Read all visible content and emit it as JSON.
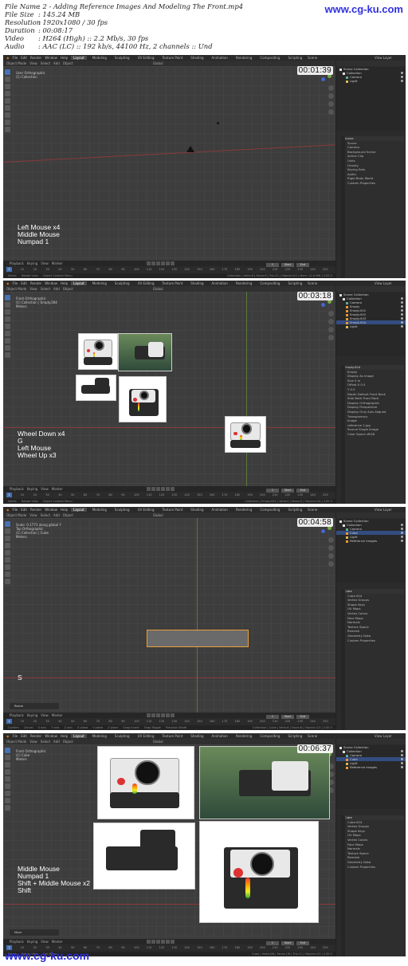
{
  "header": {
    "rows": [
      {
        "label": "File Name",
        "value": ":  2 - Adding Reference Images And Modeling The Front.mp4"
      },
      {
        "label": "File Size",
        "value": ":  145.24 MB"
      },
      {
        "label": "Resolution",
        "value": ":  1920x1080 / 30 fps"
      },
      {
        "label": "Duration",
        "value": ":  00:08:17"
      },
      {
        "label": "Video",
        "value": ":  H264 (High) :: 2.2 Mb/s, 30 fps"
      },
      {
        "label": "Audio",
        "value": ":  AAC (LC) :: 192 kb/s, 44100 Hz, 2 channels :: Und"
      }
    ]
  },
  "watermark": {
    "top": "www.cg-ku.com",
    "bottom": "www.cg-ku.com"
  },
  "menu": {
    "items": [
      "File",
      "Edit",
      "Render",
      "Window",
      "Help"
    ],
    "workspaces": [
      "Layout",
      "Modeling",
      "Sculpting",
      "UV Editing",
      "Texture Paint",
      "Shading",
      "Animation",
      "Rendering",
      "Compositing",
      "Scripting"
    ],
    "scene": "Scene",
    "view_layer": "View Layer"
  },
  "viewport_header": {
    "mode": "Object Mode",
    "menu": [
      "View",
      "Select",
      "Add",
      "Object"
    ],
    "transform": "Global"
  },
  "timeline": {
    "menu": [
      "Playback",
      "Keying",
      "View",
      "Marker"
    ],
    "frame": "1",
    "start_label": "Start",
    "start": "1",
    "end_label": "End",
    "end": "250",
    "ticks": [
      "0",
      "10",
      "20",
      "30",
      "40",
      "50",
      "60",
      "70",
      "80",
      "90",
      "100",
      "110",
      "120",
      "130",
      "140",
      "150",
      "160",
      "170",
      "180",
      "190",
      "200",
      "210",
      "220",
      "230",
      "240",
      "250"
    ]
  },
  "frames": [
    {
      "timestamp": "00:01:39",
      "view_title": "User Orthographic",
      "view_sub": "(1) Collection",
      "keys": [
        "Left Mouse x4",
        "Middle Mouse",
        "Numpad 1"
      ],
      "status": [
        "Select",
        "Rotate View",
        "Object Context Menu"
      ],
      "status_right": "Collection | Verts:8 | Faces:6 | Tris:12 | Objects:0/3 | Mem: 12.8 MiB | 2.83.3",
      "outliner": [
        {
          "name": "Scene Collection",
          "sel": false
        },
        {
          "name": "Collection",
          "sel": false
        },
        {
          "name": "Camera",
          "sel": false
        },
        {
          "name": "Light",
          "sel": false
        }
      ],
      "props_title": "Scene",
      "props_rows": [
        "Scene",
        "Camera",
        "Background Scene",
        "Active Clip",
        "Units",
        "Gravity",
        "Keying Sets",
        "Audio",
        "Rigid Body World",
        "Custom Properties"
      ]
    },
    {
      "timestamp": "00:03:18",
      "view_title": "Front Orthographic",
      "view_sub": "(1) Collection | Empty.004",
      "view_unit": "Meters",
      "keys": [
        "Wheel Down x4",
        "G",
        "Left Mouse",
        "Wheel Up x3"
      ],
      "status": [
        "Select",
        "Rotate View",
        "Object Context Menu"
      ],
      "status_right": "Collection | Empty.004 | Verts:0 | Faces:0 | Objects:1/6 | 2.83.3",
      "outliner": [
        {
          "name": "Scene Collection",
          "sel": false
        },
        {
          "name": "Collection",
          "sel": false
        },
        {
          "name": "Camera",
          "sel": false
        },
        {
          "name": "Empty",
          "sel": false
        },
        {
          "name": "Empty.001",
          "sel": false
        },
        {
          "name": "Empty.002",
          "sel": false
        },
        {
          "name": "Empty.003",
          "sel": false
        },
        {
          "name": "Empty.004",
          "sel": true
        },
        {
          "name": "Light",
          "sel": false
        }
      ],
      "props_title": "Empty.004",
      "props_rows": [
        "Empty",
        "Display As  Image",
        "Size  5 m",
        "Offset X  0.5",
        "Y  0.5",
        "Depth  Default  Front  Back",
        "Side  Both  Front  Back",
        "Display Orthographic",
        "Display Perspective",
        "Display Only Axis Aligned",
        "Transparency",
        "Image",
        "reference 2.jpg",
        "Source  Single Image",
        "Color Space  sRGB"
      ]
    },
    {
      "timestamp": "00:04:58",
      "view_title": "Top Orthographic",
      "view_sub": "(1) Collection | Cube",
      "view_unit": "Meters",
      "view_scale": "Scale: 0.1773  along global Y",
      "keys": [
        "S"
      ],
      "op_panel": "Resize",
      "status": [
        "Confirm",
        "Cancel",
        "X axis",
        "Y axis",
        "Z axis",
        "X plane",
        "Y plane",
        "Z plane",
        "Snap Invert",
        "Snap Toggle",
        "Precision Mode"
      ],
      "status_right": "Collection | Cube | Verts:8 | Faces:6 | Objects:1/3 | 2.83.3",
      "outliner": [
        {
          "name": "Scene Collection",
          "sel": false
        },
        {
          "name": "Collection",
          "sel": false
        },
        {
          "name": "Camera",
          "sel": false
        },
        {
          "name": "Cube",
          "sel": true
        },
        {
          "name": "Light",
          "sel": false
        },
        {
          "name": "Reference images",
          "sel": false
        }
      ],
      "props_title": "Cube",
      "props_rows": [
        "Cube.004",
        "Vertex Groups",
        "Shape Keys",
        "UV Maps",
        "Vertex Colors",
        "Face Maps",
        "Normals",
        "Texture Space",
        "Remesh",
        "Geometry Data",
        "Custom Properties"
      ]
    },
    {
      "timestamp": "00:06:37",
      "view_title": "Front Orthographic",
      "view_sub": "(1) Cube",
      "view_unit": "Meters",
      "keys": [
        "Middle Mouse",
        "Numpad 1",
        "Shift + Middle Mouse x2",
        "",
        "Shift"
      ],
      "op_panel": "Move",
      "status": [
        "Select",
        "Rotate View",
        "Call Menu"
      ],
      "status_right": "Cube | Verts:8/8 | Faces:1/6 | Tris:12 | Objects:1/3 | 2.83.3",
      "outliner": [
        {
          "name": "Scene Collection",
          "sel": false
        },
        {
          "name": "Collection",
          "sel": false
        },
        {
          "name": "Camera",
          "sel": false
        },
        {
          "name": "Cube",
          "sel": true
        },
        {
          "name": "Light",
          "sel": false
        },
        {
          "name": "Reference images",
          "sel": false
        }
      ],
      "props_title": "Cube",
      "props_rows": [
        "Cube.004",
        "Vertex Groups",
        "Shape Keys",
        "UV Maps",
        "Vertex Colors",
        "Face Maps",
        "Normals",
        "Texture Space",
        "Remesh",
        "Geometry Data",
        "Custom Properties"
      ]
    }
  ]
}
